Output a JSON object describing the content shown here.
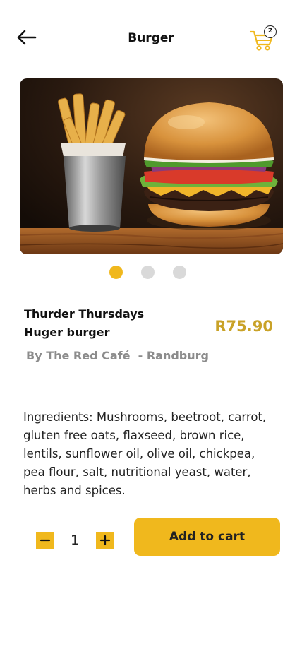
{
  "header": {
    "title": "Burger",
    "back_icon": "arrow-left-icon",
    "cart_icon": "shopping-cart-icon",
    "cart_count": "2"
  },
  "carousel": {
    "image": "burger-and-fries-photo",
    "slide_count": 3,
    "active_index": 0
  },
  "product": {
    "name_line1": "Thurder Thursdays",
    "name_line2": "Huger burger",
    "price": "R75.90",
    "vendor": "By The Red Café  - Randburg",
    "ingredients": "Ingredients: Mushrooms, beetroot, carrot, gluten free oats, flaxseed, brown rice, lentils, sunflower oil, olive oil, chickpea, pea flour, salt, nutritional yeast, water, herbs and spices."
  },
  "quantity": {
    "value": "1",
    "minus_icon": "minus-icon",
    "plus_icon": "plus-icon"
  },
  "actions": {
    "add_to_cart_label": "Add to cart"
  },
  "colors": {
    "accent": "#f0b81d",
    "price": "#c9a227",
    "vendor": "#8c8c8c",
    "dot_inactive": "#d9d9d9"
  }
}
